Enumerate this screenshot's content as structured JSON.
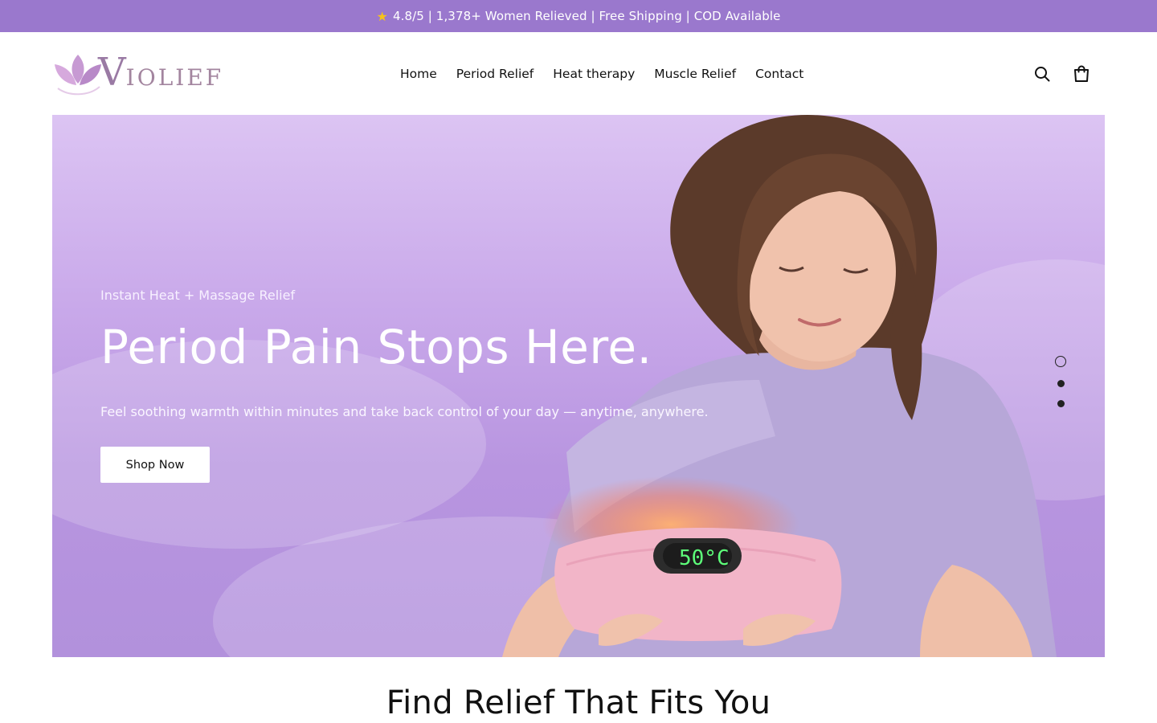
{
  "announcement": {
    "star_icon": "star-icon",
    "text": "4.8/5 | 1,378+ Women Relieved | Free Shipping | COD Available",
    "background": "#9a78cd"
  },
  "header": {
    "logo": {
      "letter": "V",
      "text": "IOLIEF",
      "icon": "lotus-icon"
    },
    "nav": [
      "Home",
      "Period Relief",
      "Heat therapy",
      "Muscle Relief",
      "Contact"
    ],
    "icons": [
      "search-icon",
      "shopping-bag-icon"
    ]
  },
  "hero": {
    "eyebrow": "Instant Heat + Massage Relief",
    "title": "Period Pain Stops Here.",
    "subtitle": "Feel soothing warmth within minutes and take back control of your day — anytime, anywhere.",
    "cta": "Shop Now",
    "device_display": "50°C",
    "slides": 3,
    "active_slide": 1
  },
  "section": {
    "title": "Find Relief That Fits You"
  }
}
